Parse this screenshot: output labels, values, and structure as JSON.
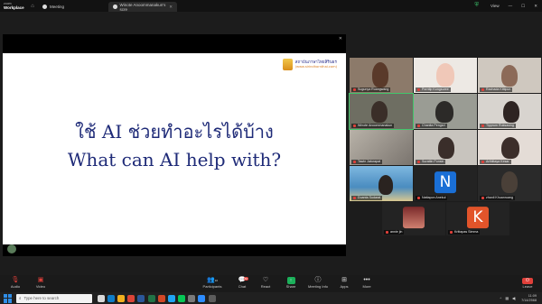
{
  "app": {
    "logo_line1": "zoom",
    "logo_line2": "Workplace"
  },
  "tabs": [
    {
      "label": "Meeting"
    },
    {
      "label": "Winote Anoommanakun's scre"
    }
  ],
  "titlebar": {
    "view_label": "View"
  },
  "slide": {
    "brand_line1": "สถาบันภาษาไทยสิรินธร",
    "brand_line2": "(www.sirindhornthai.com)",
    "title_thai": "ใช้ AI ช่วยทำอะไรได้บ้าง",
    "title_en": "What can AI help with?"
  },
  "participants": [
    {
      "name": "Sugunya Ruangwang"
    },
    {
      "name": "Porntip Kongsuree"
    },
    {
      "name": "Rachada Kittipun"
    },
    {
      "name": "Winote Anoommanakun"
    },
    {
      "name": "Chanita Pengsri"
    },
    {
      "name": "Tipprum Ruksasing"
    },
    {
      "name": "Tawin Jaturapat"
    },
    {
      "name": "Surattin Punsin"
    },
    {
      "name": "Arthittaya Kesar"
    },
    {
      "name": "Duanta Sudarat"
    },
    {
      "name": "Nattapon Anekul",
      "initial": "N"
    },
    {
      "name": "zhanli Khuanruang"
    },
    {
      "name": "annie jin"
    },
    {
      "name": "Krittapas Simma",
      "initial": "K"
    }
  ],
  "toolbar": {
    "audio": "Audio",
    "video": "Video",
    "participants": "Participants",
    "participants_count": "16",
    "chat": "Chat",
    "chat_badge": "50",
    "react": "React",
    "share": "Share",
    "meeting_info": "Meeting Info",
    "apps": "Apps",
    "more": "More",
    "leave": "Leave"
  },
  "taskbar": {
    "search_placeholder": "Type here to search",
    "time": "11:09",
    "date": "7/14/2568"
  },
  "colors": {
    "accent_green": "#42c56b",
    "leave_red": "#e0403a",
    "slide_title": "#1f2b78"
  }
}
